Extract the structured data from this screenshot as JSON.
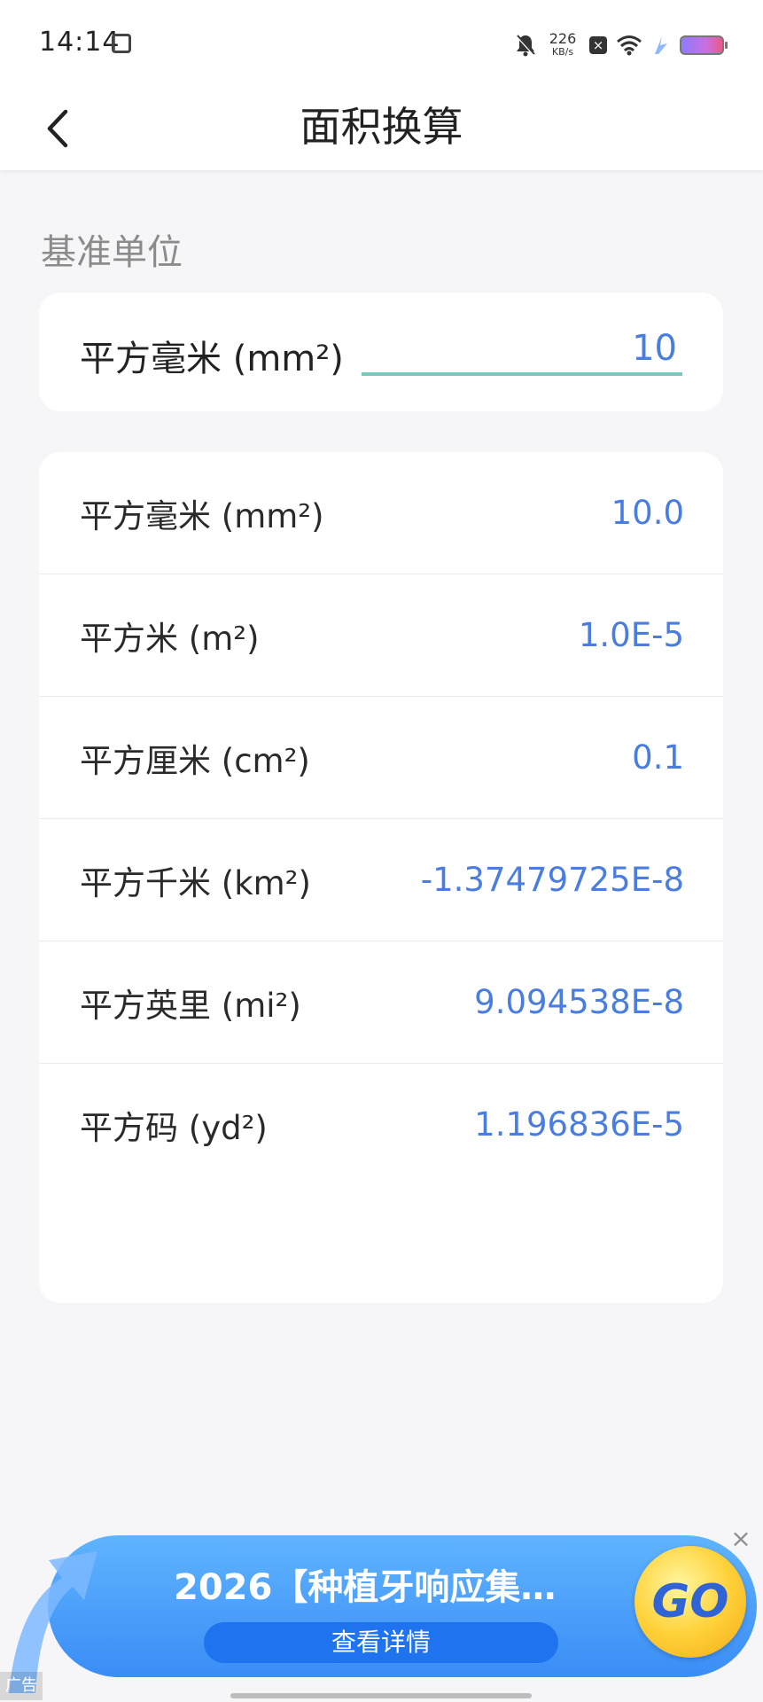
{
  "status_bar": {
    "time": "14:14",
    "net_speed_value": "226",
    "net_speed_unit": "KB/s"
  },
  "header": {
    "title": "面积换算"
  },
  "section": {
    "label": "基准单位"
  },
  "base_input": {
    "unit_label": "平方毫米 (mm²)",
    "value": "10"
  },
  "results": [
    {
      "label": "平方毫米 (mm²)",
      "value": "10.0"
    },
    {
      "label": "平方米 (m²)",
      "value": "1.0E-5"
    },
    {
      "label": "平方厘米 (cm²)",
      "value": "0.1"
    },
    {
      "label": "平方千米 (km²)",
      "value": "-1.37479725E-8"
    },
    {
      "label": "平方英里 (mi²)",
      "value": "9.094538E-8"
    },
    {
      "label": "平方码 (yd²)",
      "value": "1.196836E-5"
    }
  ],
  "ad": {
    "title": "2026【种植牙响应集…",
    "button_label": "查看详情",
    "badge": "GO",
    "tag": "广告"
  },
  "colors": {
    "accent": "#4a7de0",
    "underline": "#78c8c0"
  }
}
